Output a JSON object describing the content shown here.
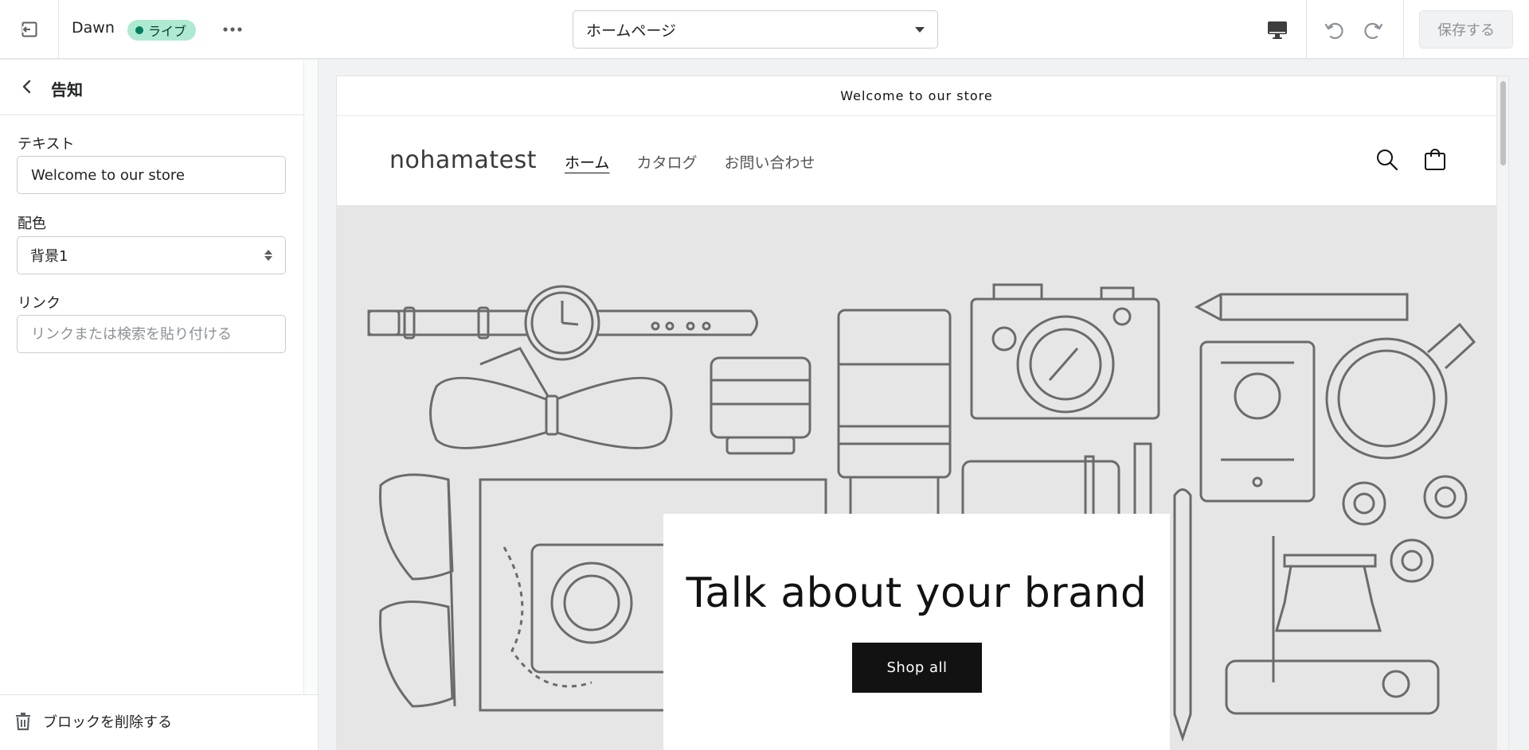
{
  "topbar": {
    "theme_name": "Dawn",
    "live_badge": "ライブ",
    "page_selector": "ホームページ",
    "save_label": "保存する"
  },
  "sidebar": {
    "section_title": "告知",
    "text_field": {
      "label": "テキスト",
      "value": "Welcome to our store"
    },
    "color_field": {
      "label": "配色",
      "value": "背景1"
    },
    "link_field": {
      "label": "リンク",
      "placeholder": "リンクまたは検索を貼り付ける"
    },
    "delete_label": "ブロックを削除する"
  },
  "preview": {
    "announcement": "Welcome to our store",
    "logo": "nohamatest",
    "nav": [
      "ホーム",
      "カタログ",
      "お問い合わせ"
    ],
    "hero_heading": "Talk about your brand",
    "hero_button": "Shop all"
  },
  "colors": {
    "live_badge_bg": "#aee9d1",
    "live_dot": "#007f5f",
    "hero_bg": "#e6e6e6",
    "button_dark": "#121212"
  }
}
